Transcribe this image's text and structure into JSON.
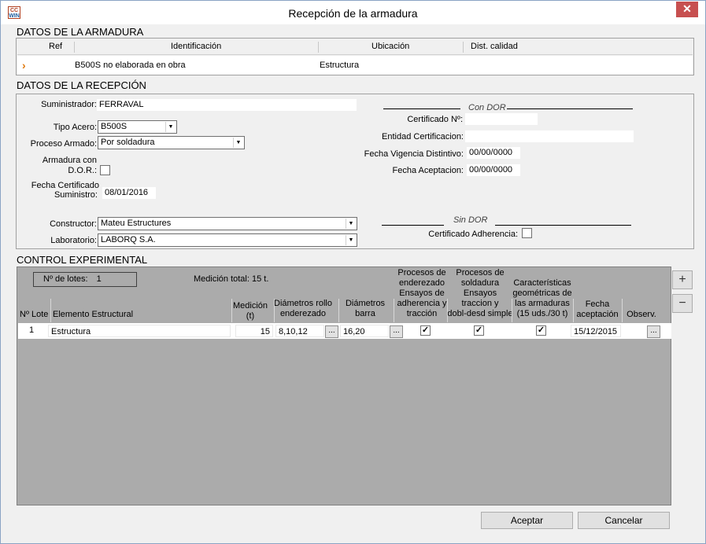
{
  "window": {
    "title": "Recepción de la armadura",
    "icon_text_top": "CC",
    "icon_text_bottom": "WIN",
    "close_label": "✕"
  },
  "armadura": {
    "section_title": "DATOS DE LA ARMADURA",
    "columns": [
      "Ref",
      "Identificación",
      "Ubicación",
      "Dist. calidad"
    ],
    "row": {
      "identificacion": "B500S no elaborada en obra",
      "ubicacion": "Estructura",
      "dist_calidad": ""
    }
  },
  "recepcion": {
    "section_title": "DATOS DE LA RECEPCIÓN",
    "suministrador_label": "Suministrador:",
    "suministrador_value": "FERRAVAL",
    "tipo_acero_label": "Tipo Acero:",
    "tipo_acero_value": "B500S",
    "proceso_armado_label": "Proceso Armado:",
    "proceso_armado_value": "Por soldadura",
    "armadura_dor_label_1": "Armadura con",
    "armadura_dor_label_2": "D.O.R.:",
    "armadura_dor_checked": false,
    "fecha_cert_label_1": "Fecha Certificado",
    "fecha_cert_label_2": "Suministro:",
    "fecha_cert_value": "08/01/2016",
    "constructor_label": "Constructor:",
    "constructor_value": "Mateu Estructures",
    "laboratorio_label": "Laboratorio:",
    "laboratorio_value": "LABORQ S.A.",
    "con_dor_legend": "Con DOR",
    "certificado_no_label": "Certificado Nº:",
    "certificado_no_value": "",
    "entidad_cert_label": "Entidad Certificacion:",
    "entidad_cert_value": "",
    "fecha_vigencia_label": "Fecha Vigencia Distintivo:",
    "fecha_vigencia_value": "00/00/0000",
    "fecha_aceptacion_label": "Fecha Aceptacion:",
    "fecha_aceptacion_value": "00/00/0000",
    "sin_dor_legend": "Sin DOR",
    "cert_adherencia_label": "Certificado Adherencia:",
    "cert_adherencia_checked": false
  },
  "control": {
    "section_title": "CONTROL EXPERIMENTAL",
    "lotes_label": "Nº de lotes:",
    "lotes_value": "1",
    "medicion_total": "Medición total: 15 t.",
    "headers": {
      "lote": "Nº Lote",
      "elemento": "Elemento Estructural",
      "medicion_1": "Medición",
      "medicion_2": "(t)",
      "diam_rollo_1": "Diámetros rollo",
      "diam_rollo_2": "enderezado",
      "diam_barra_1": "Diámetros",
      "diam_barra_2": "barra",
      "proc_enderezado_1": "Procesos de",
      "proc_enderezado_2": "enderezado",
      "proc_enderezado_3": "Ensayos de",
      "proc_enderezado_4": "adherencia y",
      "proc_enderezado_5": "tracción",
      "proc_soldadura_1": "Procesos de",
      "proc_soldadura_2": "soldadura",
      "proc_soldadura_3": "Ensayos",
      "proc_soldadura_4": "traccion y",
      "proc_soldadura_5": "dobl-desd simple",
      "caract_1": "Características",
      "caract_2": "geométricas de",
      "caract_3": "las armaduras",
      "caract_4": "(15 uds./30 t)",
      "fecha_1": "Fecha",
      "fecha_2": "aceptación",
      "observ": "Observ."
    },
    "row": {
      "lote": "1",
      "elemento": "Estructura",
      "medicion": "15",
      "diam_rollo": "8,10,12",
      "diam_barra": "16,20",
      "proc_enderezado_checked": true,
      "proc_soldadura_checked": true,
      "caract_checked": true,
      "fecha": "15/12/2015",
      "dots": "..."
    },
    "add_label": "+",
    "remove_label": "−"
  },
  "buttons": {
    "accept": "Aceptar",
    "cancel": "Cancelar"
  }
}
